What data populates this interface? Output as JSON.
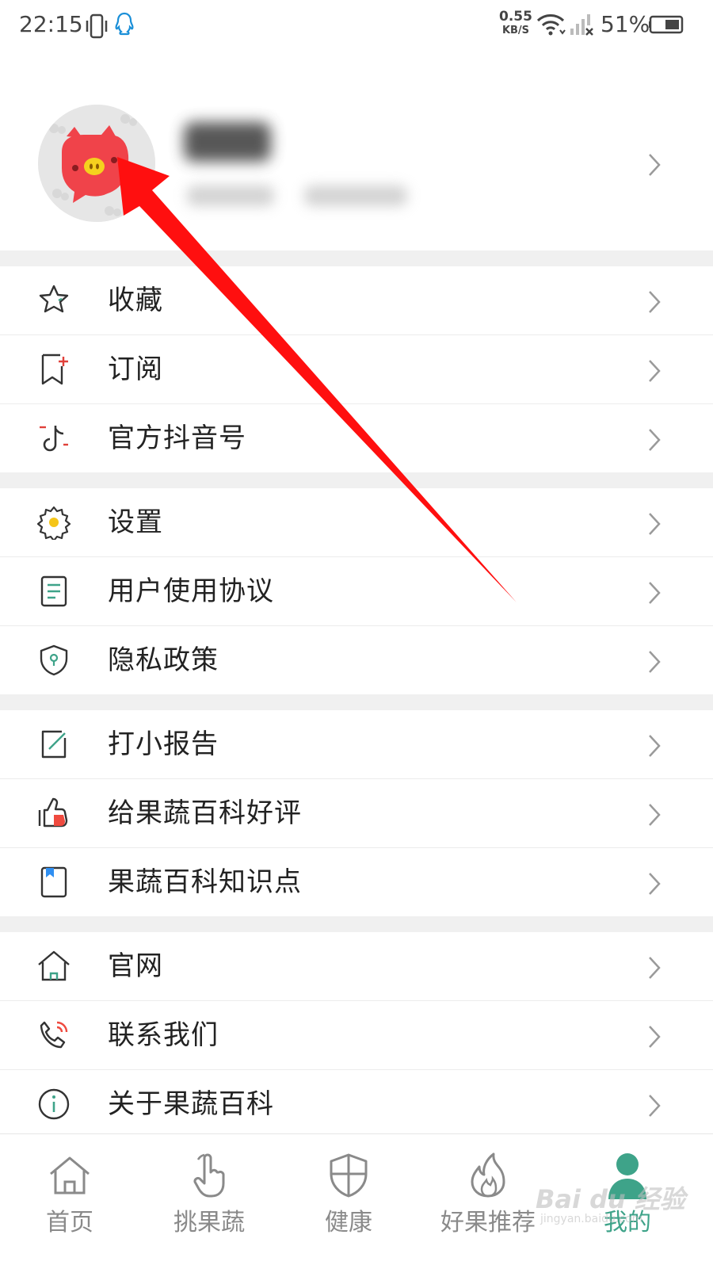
{
  "status_bar": {
    "time": "22:15",
    "net_speed_value": "0.55",
    "net_speed_unit": "KB/S",
    "battery_percent": "51%"
  },
  "profile": {
    "avatar_icon": "pig-avatar-icon"
  },
  "menu_groups": [
    [
      {
        "label": "收藏",
        "icon": "star-icon"
      },
      {
        "label": "订阅",
        "icon": "subscribe-icon"
      },
      {
        "label": "官方抖音号",
        "icon": "douyin-icon"
      }
    ],
    [
      {
        "label": "设置",
        "icon": "gear-icon"
      },
      {
        "label": "用户使用协议",
        "icon": "document-icon"
      },
      {
        "label": "隐私政策",
        "icon": "shield-icon"
      }
    ],
    [
      {
        "label": "打小报告",
        "icon": "edit-icon"
      },
      {
        "label": "给果蔬百科好评",
        "icon": "thumbs-up-icon"
      },
      {
        "label": "果蔬百科知识点",
        "icon": "bookmark-icon"
      }
    ],
    [
      {
        "label": "官网",
        "icon": "home-icon"
      },
      {
        "label": "联系我们",
        "icon": "phone-icon"
      },
      {
        "label": "关于果蔬百科",
        "icon": "info-icon"
      }
    ]
  ],
  "tabs": [
    {
      "label": "首页",
      "icon": "home-icon"
    },
    {
      "label": "挑果蔬",
      "icon": "hand-pointer-icon"
    },
    {
      "label": "健康",
      "icon": "shield-icon"
    },
    {
      "label": "好果推荐",
      "icon": "flame-icon"
    },
    {
      "label": "我的",
      "icon": "person-icon",
      "active": true
    }
  ],
  "watermark": {
    "text": "Bai du 经验",
    "sub": "jingyan.baidu.com"
  },
  "colors": {
    "accent": "#3ea389",
    "annotation_arrow": "#ff0f0f",
    "separator": "#f0f0f0"
  }
}
